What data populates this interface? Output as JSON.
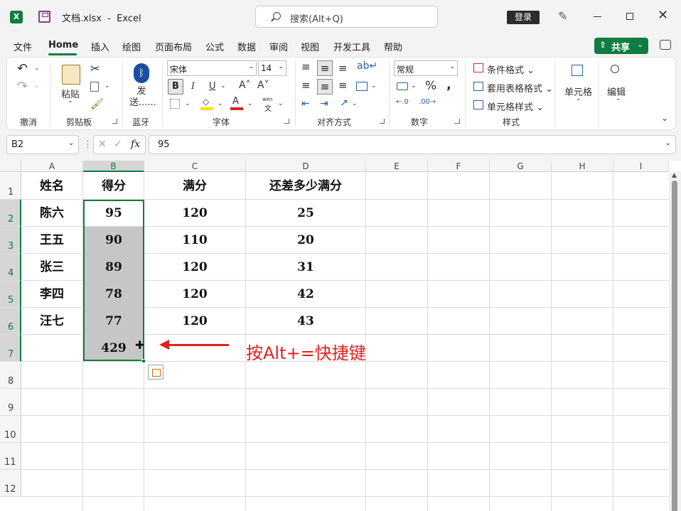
{
  "window": {
    "file_name": "文档.xlsx",
    "separator": "-",
    "app_name": "Excel",
    "search_placeholder": "搜索(Alt+Q)",
    "login_label": "登录",
    "app_icon_letter": "X"
  },
  "menu": {
    "tabs": [
      "文件",
      "Home",
      "插入",
      "绘图",
      "页面布局",
      "公式",
      "数据",
      "审阅",
      "视图",
      "开发工具",
      "帮助"
    ],
    "active_tab": "Home",
    "share_label": "共享"
  },
  "ribbon": {
    "undo_group": "撤消",
    "clipboard": {
      "paste": "粘贴",
      "label": "剪贴板"
    },
    "bluetooth": {
      "send": "发送......",
      "label": "蓝牙"
    },
    "font": {
      "name": "宋体",
      "size": "14",
      "label": "字体",
      "bold": "B",
      "italic": "I",
      "pinyin": "wén",
      "pinyin_char": "文"
    },
    "alignment": {
      "label": "对齐方式"
    },
    "number": {
      "format": "常规",
      "label": "数字",
      "percent": "%"
    },
    "styles": {
      "conditional": "条件格式",
      "table": "套用表格格式",
      "cell_styles": "单元格样式",
      "label": "样式"
    },
    "cells": {
      "label": "单元格"
    },
    "editing": {
      "label": "编辑"
    }
  },
  "formula_bar": {
    "name_box": "B2",
    "fx": "fx",
    "value": "95"
  },
  "sheet": {
    "columns": [
      "A",
      "B",
      "C",
      "D",
      "E",
      "F",
      "G",
      "H",
      "I"
    ],
    "selected_column": "B",
    "rows": [
      "1",
      "2",
      "3",
      "4",
      "5",
      "6",
      "7",
      "8",
      "9",
      "10",
      "11",
      "12"
    ],
    "headers": [
      "姓名",
      "得分",
      "满分",
      "还差多少满分"
    ],
    "data": [
      {
        "name": "陈六",
        "score": "95",
        "full": "120",
        "diff": "25"
      },
      {
        "name": "王五",
        "score": "90",
        "full": "110",
        "diff": "20"
      },
      {
        "name": "张三",
        "score": "89",
        "full": "120",
        "diff": "31"
      },
      {
        "name": "李四",
        "score": "78",
        "full": "120",
        "diff": "42"
      },
      {
        "name": "汪七",
        "score": "77",
        "full": "120",
        "diff": "43"
      }
    ],
    "sum_value": "429",
    "annotation": "按Alt+=快捷键",
    "accent_color": "#107c41",
    "annotation_color": "#e02020"
  }
}
